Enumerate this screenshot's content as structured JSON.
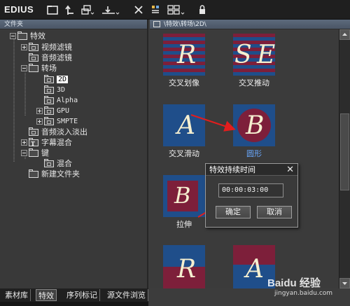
{
  "app": {
    "title": "EDIUS"
  },
  "left_panel": {
    "header": "文件夹",
    "tree": [
      {
        "label": "特效",
        "key": "effects"
      },
      {
        "label": "视频滤镜",
        "key": "video-filter"
      },
      {
        "label": "音频滤镜",
        "key": "audio-filter"
      },
      {
        "label": "转场",
        "key": "transition"
      },
      {
        "label": "2D",
        "key": "2d",
        "selected": true
      },
      {
        "label": "3D",
        "key": "3d"
      },
      {
        "label": "Alpha",
        "key": "alpha"
      },
      {
        "label": "GPU",
        "key": "gpu"
      },
      {
        "label": "SMPTE",
        "key": "smpte"
      },
      {
        "label": "音频淡入淡出",
        "key": "audio-fade"
      },
      {
        "label": "字幕混合",
        "key": "title-mix"
      },
      {
        "label": "键",
        "key": "key"
      },
      {
        "label": "混合",
        "key": "blend"
      },
      {
        "label": "新建文件夹",
        "key": "new-folder"
      }
    ],
    "tabs": [
      "素材库",
      "特效",
      "序列标记",
      "源文件浏览"
    ]
  },
  "right_panel": {
    "path": "\\特效\\转场\\2D\\",
    "items": [
      {
        "label": "交叉划像",
        "selected": false
      },
      {
        "label": "交叉推动",
        "selected": false
      },
      {
        "label": "交叉滑动",
        "selected": false,
        "letter": "A"
      },
      {
        "label": "圆形",
        "selected": true,
        "letter": "B"
      },
      {
        "label": "拉伸",
        "selected": false,
        "letter": "B"
      },
      {
        "label": "",
        "selected": false,
        "letter": "R"
      },
      {
        "label": "",
        "selected": false,
        "letter": "A"
      }
    ]
  },
  "dialog": {
    "title": "特效持续时间",
    "duration_value": "00:00:03:00",
    "ok_label": "确定",
    "cancel_label": "取消"
  },
  "watermark": {
    "brand": "Baidu 经验",
    "url": "jingyan.baidu.com"
  },
  "colors": {
    "accent_blue": "#1f4e8a",
    "accent_red": "#7d1f3a",
    "selection": "#6aa9ff"
  }
}
